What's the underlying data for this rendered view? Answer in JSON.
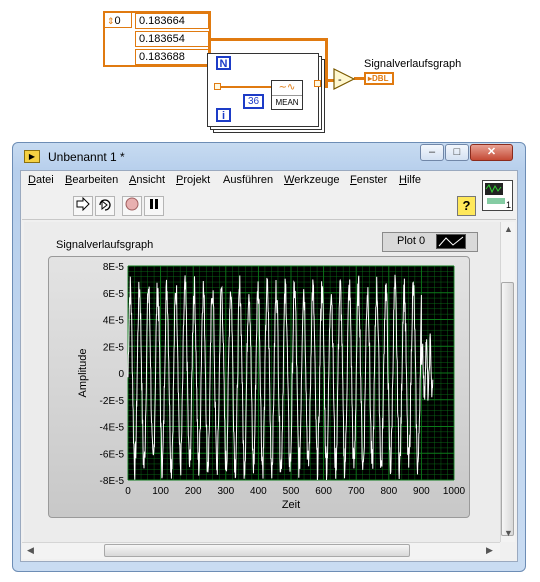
{
  "block_diagram": {
    "array_index": "0",
    "array_values": [
      "0.183664",
      "0.183654",
      "0.183688"
    ],
    "loop_count_terminal": "N",
    "iteration_terminal": "i",
    "constant": "36",
    "mean_label": "MEAN",
    "graph_indicator_label": "Signalverlaufsgraph",
    "graph_indicator_type": "DBL"
  },
  "window": {
    "title": "Unbenannt 1 *",
    "controls": [
      "–",
      "□",
      "✕"
    ]
  },
  "menu": [
    {
      "label": "Datei",
      "accel": "D"
    },
    {
      "label": "Bearbeiten",
      "accel": "B"
    },
    {
      "label": "Ansicht",
      "accel": "A"
    },
    {
      "label": "Projekt",
      "accel": "P"
    },
    {
      "label": "Ausführen",
      "accel": "f"
    },
    {
      "label": "Werkzeuge",
      "accel": "W"
    },
    {
      "label": "Fenster",
      "accel": "F"
    },
    {
      "label": "Hilfe",
      "accel": "H"
    }
  ],
  "toolbar": {
    "run_icon": "run-arrow-icon",
    "run_continuous_icon": "run-continuously-icon",
    "abort_icon": "abort-stop-icon",
    "pause_icon": "pause-icon",
    "help_label": "?",
    "connector_pane_number": "1"
  },
  "graph": {
    "title": "Signalverlaufsgraph",
    "legend_label": "Plot 0",
    "plot_bg": "#000000",
    "grid_color": "#0c7a1a",
    "trace_color": "#ffffff"
  },
  "chart_data": {
    "type": "line",
    "title": "Signalverlaufsgraph",
    "xlabel": "Zeit",
    "ylabel": "Amplitude",
    "xlim": [
      0,
      1000
    ],
    "ylim": [
      -8e-05,
      8e-05
    ],
    "xticks": [
      "0",
      "100",
      "200",
      "300",
      "400",
      "500",
      "600",
      "700",
      "800",
      "900",
      "1000"
    ],
    "yticks": [
      "8E-5",
      "6E-5",
      "4E-5",
      "2E-5",
      "0",
      "-2E-5",
      "-4E-5",
      "-6E-5",
      "-8E-5"
    ],
    "grid": true,
    "legend": "Plot 0",
    "series": [
      {
        "name": "Plot 0",
        "segments": [
          {
            "x_range": [
              0,
              900
            ],
            "period": 28,
            "amplitude": 6.6e-05,
            "noise": 1.2e-05,
            "offset": -3e-06
          },
          {
            "x_range": [
              900,
              935
            ],
            "period": 12,
            "amplitude": 2e-05,
            "noise": 8e-06,
            "offset": 3e-06
          }
        ]
      }
    ]
  }
}
